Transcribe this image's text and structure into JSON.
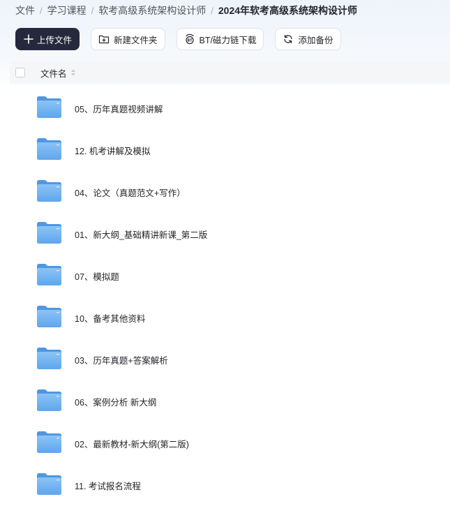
{
  "breadcrumb": {
    "items": [
      "文件",
      "学习课程",
      "软考高级系统架构设计师"
    ],
    "current": "2024年软考高级系统架构设计师",
    "separator": "/"
  },
  "toolbar": {
    "upload_label": "上传文件",
    "new_folder_label": "新建文件夹",
    "bt_label": "BT/磁力链下载",
    "backup_label": "添加备份"
  },
  "list": {
    "column_name": "文件名",
    "folders": [
      "05、历年真题视频讲解",
      "12. 机考讲解及模拟",
      "04、论文（真题范文+写作）",
      "01、新大纲_基础精讲新课_第二版",
      "07、模拟题",
      "10、备考其他资料",
      "03、历年真题+答案解析",
      "06、案例分析 新大纲",
      "02、最新教材-新大纲(第二版)",
      "11. 考试报名流程"
    ]
  },
  "colors": {
    "primary_button": "#26293d",
    "folder_blue": "#6fb0ef"
  }
}
